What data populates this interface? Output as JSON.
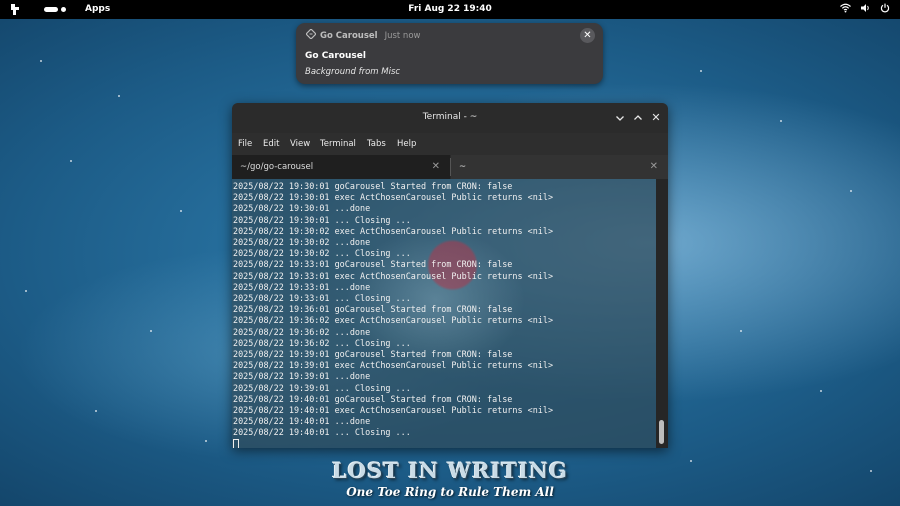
{
  "topbar": {
    "apps_label": "Apps",
    "clock": "Fri Aug 22  19:40",
    "icons": [
      "launcher-icon",
      "workspace-indicator",
      "wifi-icon",
      "volume-icon",
      "power-icon"
    ]
  },
  "notification": {
    "app_name": "Go Carousel",
    "time": "Just now",
    "title": "Go Carousel",
    "body": "Background from Misc",
    "close_icon": "close-icon"
  },
  "terminal": {
    "title": "Terminal - ~",
    "menu": [
      "File",
      "Edit",
      "View",
      "Terminal",
      "Tabs",
      "Help"
    ],
    "tabs": [
      {
        "label": "~/go/go-carousel",
        "active": true
      },
      {
        "label": "~",
        "active": false
      }
    ],
    "log_lines": [
      "2025/08/22 19:30:01 goCarousel Started from CRON: false",
      "2025/08/22 19:30:01 exec ActChosenCarousel Public returns <nil>",
      "2025/08/22 19:30:01 ...done",
      "2025/08/22 19:30:01 ... Closing ...",
      "2025/08/22 19:30:02 exec ActChosenCarousel Public returns <nil>",
      "2025/08/22 19:30:02 ...done",
      "2025/08/22 19:30:02 ... Closing ...",
      "2025/08/22 19:33:01 goCarousel Started from CRON: false",
      "2025/08/22 19:33:01 exec ActChosenCarousel Public returns <nil>",
      "2025/08/22 19:33:01 ...done",
      "2025/08/22 19:33:01 ... Closing ...",
      "2025/08/22 19:36:01 goCarousel Started from CRON: false",
      "2025/08/22 19:36:02 exec ActChosenCarousel Public returns <nil>",
      "2025/08/22 19:36:02 ...done",
      "2025/08/22 19:36:02 ... Closing ...",
      "2025/08/22 19:39:01 goCarousel Started from CRON: false",
      "2025/08/22 19:39:01 exec ActChosenCarousel Public returns <nil>",
      "2025/08/22 19:39:01 ...done",
      "2025/08/22 19:39:01 ... Closing ...",
      "2025/08/22 19:40:01 goCarousel Started from CRON: false",
      "2025/08/22 19:40:01 exec ActChosenCarousel Public returns <nil>",
      "2025/08/22 19:40:01 ...done",
      "2025/08/22 19:40:01 ... Closing ..."
    ]
  },
  "wallpaper": {
    "brand_title": "LOST IN WRITING",
    "brand_tagline": "One Toe Ring to Rule Them All"
  },
  "colors": {
    "topbar_bg": "#000000",
    "notification_bg": "#3b3b3e",
    "titlebar_bg": "#2b2b2b",
    "wallpaper_base": "#1c5b86"
  }
}
